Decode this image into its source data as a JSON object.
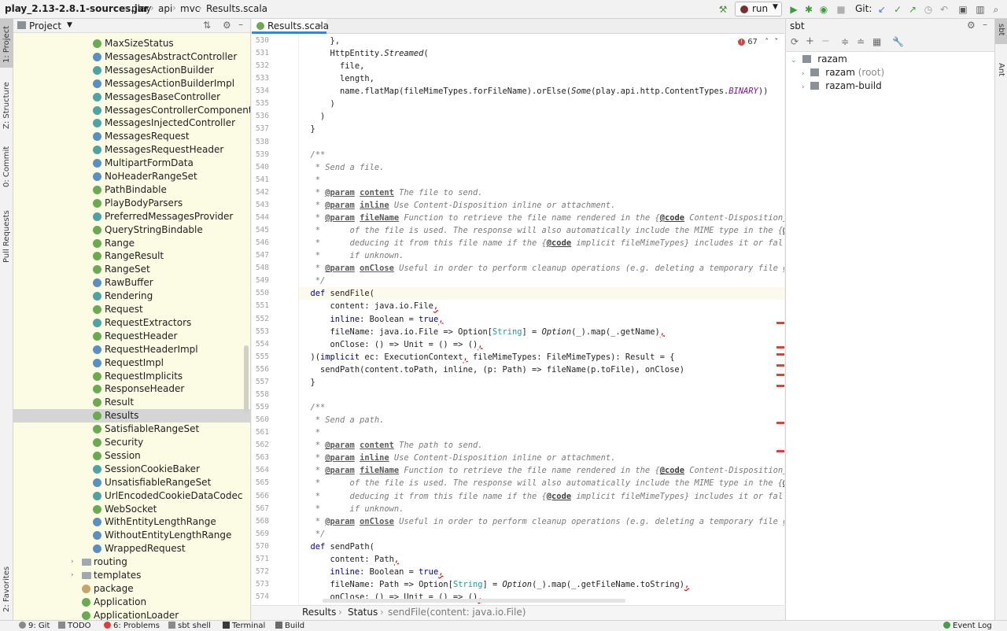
{
  "navbar": {
    "crumbs": [
      "play_2.13-2.8.1-sources.jar",
      "play",
      "api",
      "mvc",
      "Results.scala"
    ],
    "run_config": "run",
    "git_label": "Git:"
  },
  "left_strip": {
    "tabs": [
      "1: Project",
      "Z: Structure",
      "0: Commit",
      "Pull Requests",
      "2: Favorites"
    ]
  },
  "right_strip": {
    "tabs": [
      "sbt",
      "Ant"
    ]
  },
  "project": {
    "title": "Project",
    "items": [
      {
        "label": "MaxSizeStatus",
        "icon": "object-icon",
        "indent": 118
      },
      {
        "label": "MessagesAbstractController",
        "icon": "class-icon",
        "indent": 118
      },
      {
        "label": "MessagesActionBuilder",
        "icon": "trait-icon",
        "indent": 118
      },
      {
        "label": "MessagesActionBuilderImpl",
        "icon": "class-icon",
        "indent": 118
      },
      {
        "label": "MessagesBaseController",
        "icon": "trait-icon",
        "indent": 118
      },
      {
        "label": "MessagesControllerComponents",
        "icon": "trait-icon",
        "indent": 118
      },
      {
        "label": "MessagesInjectedController",
        "icon": "trait-icon",
        "indent": 118
      },
      {
        "label": "MessagesRequest",
        "icon": "class-icon",
        "indent": 118
      },
      {
        "label": "MessagesRequestHeader",
        "icon": "trait-icon",
        "indent": 118
      },
      {
        "label": "MultipartFormData",
        "icon": "class-icon",
        "indent": 118
      },
      {
        "label": "NoHeaderRangeSet",
        "icon": "class-icon",
        "indent": 118
      },
      {
        "label": "PathBindable",
        "icon": "object-icon",
        "indent": 118
      },
      {
        "label": "PlayBodyParsers",
        "icon": "object-icon",
        "indent": 118
      },
      {
        "label": "PreferredMessagesProvider",
        "icon": "trait-icon",
        "indent": 118
      },
      {
        "label": "QueryStringBindable",
        "icon": "object-icon",
        "indent": 118
      },
      {
        "label": "Range",
        "icon": "object-icon",
        "indent": 118
      },
      {
        "label": "RangeResult",
        "icon": "object-icon",
        "indent": 118
      },
      {
        "label": "RangeSet",
        "icon": "object-icon",
        "indent": 118
      },
      {
        "label": "RawBuffer",
        "icon": "class-icon",
        "indent": 118
      },
      {
        "label": "Rendering",
        "icon": "trait-icon",
        "indent": 118
      },
      {
        "label": "Request",
        "icon": "object-icon",
        "indent": 118
      },
      {
        "label": "RequestExtractors",
        "icon": "trait-icon",
        "indent": 118
      },
      {
        "label": "RequestHeader",
        "icon": "object-icon",
        "indent": 118
      },
      {
        "label": "RequestHeaderImpl",
        "icon": "class-icon",
        "indent": 118
      },
      {
        "label": "RequestImpl",
        "icon": "class-icon",
        "indent": 118
      },
      {
        "label": "RequestImplicits",
        "icon": "object-icon",
        "indent": 118
      },
      {
        "label": "ResponseHeader",
        "icon": "object-icon",
        "indent": 118
      },
      {
        "label": "Result",
        "icon": "object-icon",
        "indent": 118
      },
      {
        "label": "Results",
        "icon": "object-icon",
        "indent": 118,
        "selected": true
      },
      {
        "label": "SatisfiableRangeSet",
        "icon": "object-icon",
        "indent": 118
      },
      {
        "label": "Security",
        "icon": "object-icon",
        "indent": 118
      },
      {
        "label": "Session",
        "icon": "object-icon",
        "indent": 118
      },
      {
        "label": "SessionCookieBaker",
        "icon": "trait-icon",
        "indent": 118
      },
      {
        "label": "UnsatisfiableRangeSet",
        "icon": "class-icon",
        "indent": 118
      },
      {
        "label": "UrlEncodedCookieDataCodec",
        "icon": "trait-icon",
        "indent": 118
      },
      {
        "label": "WebSocket",
        "icon": "object-icon",
        "indent": 118
      },
      {
        "label": "WithEntityLengthRange",
        "icon": "class-icon",
        "indent": 118
      },
      {
        "label": "WithoutEntityLengthRange",
        "icon": "class-icon",
        "indent": 118
      },
      {
        "label": "WrappedRequest",
        "icon": "class-icon",
        "indent": 118
      },
      {
        "label": "routing",
        "icon": "folder-icon",
        "indent": 104,
        "expandable": true
      },
      {
        "label": "templates",
        "icon": "folder-icon",
        "indent": 104,
        "expandable": true
      },
      {
        "label": "package",
        "icon": "package-object-icon",
        "indent": 104
      },
      {
        "label": "Application",
        "icon": "object-icon",
        "indent": 104
      },
      {
        "label": "ApplicationLoader",
        "icon": "object-icon",
        "indent": 104
      }
    ]
  },
  "editor": {
    "tab_label": "Results.scala",
    "inspection_count": "67",
    "lines": [
      {
        "n": "530",
        "segs": [
          [
            "      },",
            ""
          ]
        ]
      },
      {
        "n": "531",
        "segs": [
          [
            "      HttpEntity.",
            ""
          ],
          [
            "Streamed",
            "obj"
          ],
          [
            "(",
            ""
          ]
        ]
      },
      {
        "n": "532",
        "segs": [
          [
            "        file,",
            ""
          ]
        ]
      },
      {
        "n": "533",
        "segs": [
          [
            "        length,",
            ""
          ]
        ]
      },
      {
        "n": "534",
        "segs": [
          [
            "        name.flatMap(fileMimeTypes.forFileName).orElse(",
            ""
          ],
          [
            "Some",
            "obj"
          ],
          [
            "(play.api.http.ContentTypes.",
            ""
          ],
          [
            "BINARY",
            "const"
          ],
          [
            "))",
            ""
          ]
        ]
      },
      {
        "n": "535",
        "segs": [
          [
            "      )",
            ""
          ]
        ]
      },
      {
        "n": "536",
        "segs": [
          [
            "    )",
            ""
          ]
        ]
      },
      {
        "n": "537",
        "segs": [
          [
            "  }",
            ""
          ]
        ]
      },
      {
        "n": "538",
        "segs": [
          [
            "",
            ""
          ]
        ]
      },
      {
        "n": "539",
        "segs": [
          [
            "  /**",
            "cm"
          ]
        ]
      },
      {
        "n": "540",
        "segs": [
          [
            "   * Send a file.",
            "cm"
          ]
        ]
      },
      {
        "n": "541",
        "segs": [
          [
            "   *",
            "cm"
          ]
        ]
      },
      {
        "n": "542",
        "segs": [
          [
            "   * ",
            "cm"
          ],
          [
            "@param",
            "tag"
          ],
          [
            " ",
            "cm"
          ],
          [
            "content",
            "tag"
          ],
          [
            " The file to send.",
            "cm"
          ]
        ]
      },
      {
        "n": "543",
        "segs": [
          [
            "   * ",
            "cm"
          ],
          [
            "@param",
            "tag"
          ],
          [
            " ",
            "cm"
          ],
          [
            "inline",
            "tag"
          ],
          [
            " Use Content-Disposition inline or attachment.",
            "cm"
          ]
        ]
      },
      {
        "n": "544",
        "segs": [
          [
            "   * ",
            "cm"
          ],
          [
            "@param",
            "tag"
          ],
          [
            " ",
            "cm"
          ],
          [
            "fileName",
            "tag"
          ],
          [
            " Function to retrieve the file name rendered in the {",
            "cm"
          ],
          [
            "@code",
            "doc-ref"
          ],
          [
            " Content-Disposition}",
            "cm"
          ]
        ]
      },
      {
        "n": "545",
        "segs": [
          [
            "   *      of the file is used. The response will also automatically include the MIME type in the {",
            "cm"
          ],
          [
            "@c",
            "doc-ref"
          ]
        ]
      },
      {
        "n": "546",
        "segs": [
          [
            "   *      deducing it from this file name if the {",
            "cm"
          ],
          [
            "@code",
            "doc-ref"
          ],
          [
            " implicit fileMimeTypes} includes it or fall",
            "cm"
          ]
        ]
      },
      {
        "n": "547",
        "segs": [
          [
            "   *      if unknown.",
            "cm"
          ]
        ]
      },
      {
        "n": "548",
        "segs": [
          [
            "   * ",
            "cm"
          ],
          [
            "@param",
            "tag"
          ],
          [
            " ",
            "cm"
          ],
          [
            "onClose",
            "tag"
          ],
          [
            " Useful in order to perform cleanup operations (e.g. deleting a temporary file g",
            "cm"
          ]
        ]
      },
      {
        "n": "549",
        "segs": [
          [
            "   */",
            "cm"
          ]
        ]
      },
      {
        "n": "550",
        "current": true,
        "segs": [
          [
            "  ",
            ""
          ],
          [
            "def",
            "kw"
          ],
          [
            " sendFile(",
            ""
          ]
        ]
      },
      {
        "n": "551",
        "segs": [
          [
            "      content: java.io.File",
            ""
          ],
          [
            ",",
            "err"
          ]
        ]
      },
      {
        "n": "552",
        "segs": [
          [
            "      ",
            ""
          ],
          [
            "inline",
            "kw"
          ],
          [
            ": Boolean = ",
            ""
          ],
          [
            "true",
            "kw"
          ],
          [
            ",",
            "err"
          ]
        ]
      },
      {
        "n": "553",
        "segs": [
          [
            "      fileName: java.io.File => Option[",
            ""
          ],
          [
            "String",
            "ty"
          ],
          [
            "] = ",
            ""
          ],
          [
            "Option",
            "obj"
          ],
          [
            "(_).map(_.getName)",
            ""
          ],
          [
            ",",
            "err"
          ]
        ]
      },
      {
        "n": "554",
        "segs": [
          [
            "      onClose: () => Unit = () => ()",
            ""
          ],
          [
            ",",
            "err"
          ]
        ]
      },
      {
        "n": "555",
        "segs": [
          [
            "  )(",
            ""
          ],
          [
            "implicit",
            "kw"
          ],
          [
            " ec: ExecutionContext",
            ""
          ],
          [
            ",",
            "err"
          ],
          [
            " fileMimeTypes: FileMimeTypes): Result = {",
            ""
          ]
        ]
      },
      {
        "n": "556",
        "segs": [
          [
            "    sendPath(content.toPath, inline, (p: Path) => fileName(p.toFile), onClose)",
            ""
          ]
        ]
      },
      {
        "n": "557",
        "segs": [
          [
            "  }",
            ""
          ]
        ]
      },
      {
        "n": "558",
        "segs": [
          [
            "",
            ""
          ]
        ]
      },
      {
        "n": "559",
        "segs": [
          [
            "  /**",
            "cm"
          ]
        ]
      },
      {
        "n": "560",
        "segs": [
          [
            "   * Send a path.",
            "cm"
          ]
        ]
      },
      {
        "n": "561",
        "segs": [
          [
            "   *",
            "cm"
          ]
        ]
      },
      {
        "n": "562",
        "segs": [
          [
            "   * ",
            "cm"
          ],
          [
            "@param",
            "tag"
          ],
          [
            " ",
            "cm"
          ],
          [
            "content",
            "tag"
          ],
          [
            " The path to send.",
            "cm"
          ]
        ]
      },
      {
        "n": "563",
        "segs": [
          [
            "   * ",
            "cm"
          ],
          [
            "@param",
            "tag"
          ],
          [
            " ",
            "cm"
          ],
          [
            "inline",
            "tag"
          ],
          [
            " Use Content-Disposition inline or attachment.",
            "cm"
          ]
        ]
      },
      {
        "n": "564",
        "segs": [
          [
            "   * ",
            "cm"
          ],
          [
            "@param",
            "tag"
          ],
          [
            " ",
            "cm"
          ],
          [
            "fileName",
            "tag"
          ],
          [
            " Function to retrieve the file name rendered in the {",
            "cm"
          ],
          [
            "@code",
            "doc-ref"
          ],
          [
            " Content-Disposition}",
            "cm"
          ]
        ]
      },
      {
        "n": "565",
        "segs": [
          [
            "   *      of the file is used. The response will also automatically include the MIME type in the {",
            "cm"
          ],
          [
            "@c",
            "doc-ref"
          ]
        ]
      },
      {
        "n": "566",
        "segs": [
          [
            "   *      deducing it from this file name if the {",
            "cm"
          ],
          [
            "@code",
            "doc-ref"
          ],
          [
            " implicit fileMimeTypes} includes it or fall",
            "cm"
          ]
        ]
      },
      {
        "n": "567",
        "segs": [
          [
            "   *      if unknown.",
            "cm"
          ]
        ]
      },
      {
        "n": "568",
        "segs": [
          [
            "   * ",
            "cm"
          ],
          [
            "@param",
            "tag"
          ],
          [
            " ",
            "cm"
          ],
          [
            "onClose",
            "tag"
          ],
          [
            " Useful in order to perform cleanup operations (e.g. deleting a temporary file g",
            "cm"
          ]
        ]
      },
      {
        "n": "569",
        "segs": [
          [
            "   */",
            "cm"
          ]
        ]
      },
      {
        "n": "570",
        "segs": [
          [
            "  ",
            ""
          ],
          [
            "def",
            "kw"
          ],
          [
            " sendPath(",
            ""
          ]
        ]
      },
      {
        "n": "571",
        "segs": [
          [
            "      content: Path",
            ""
          ],
          [
            ",",
            "err"
          ]
        ]
      },
      {
        "n": "572",
        "segs": [
          [
            "      ",
            ""
          ],
          [
            "inline",
            "kw"
          ],
          [
            ": Boolean = ",
            ""
          ],
          [
            "true",
            "kw"
          ],
          [
            ",",
            "err"
          ]
        ]
      },
      {
        "n": "573",
        "segs": [
          [
            "      fileName: Path => Option[",
            ""
          ],
          [
            "String",
            "ty"
          ],
          [
            "] = ",
            ""
          ],
          [
            "Option",
            "obj"
          ],
          [
            "(_).map(_.getFileName.toString)",
            ""
          ],
          [
            ",",
            "err"
          ]
        ]
      },
      {
        "n": "574",
        "segs": [
          [
            "      onClose: () => Unit = () => ()",
            ""
          ],
          [
            ",",
            "err"
          ]
        ]
      }
    ]
  },
  "editor_breadcrumb": [
    "Results",
    "Status",
    "sendFile(content: java.io.File)"
  ],
  "sbt": {
    "title": "sbt",
    "root": "razam",
    "children": [
      {
        "label": "razam",
        "suffix": "(root)"
      },
      {
        "label": "razam-build",
        "suffix": ""
      }
    ]
  },
  "statusbar": {
    "items": [
      "9: Git",
      "TODO",
      "6: Problems",
      "sbt shell",
      "Terminal",
      "Build"
    ],
    "right": "Event Log"
  }
}
